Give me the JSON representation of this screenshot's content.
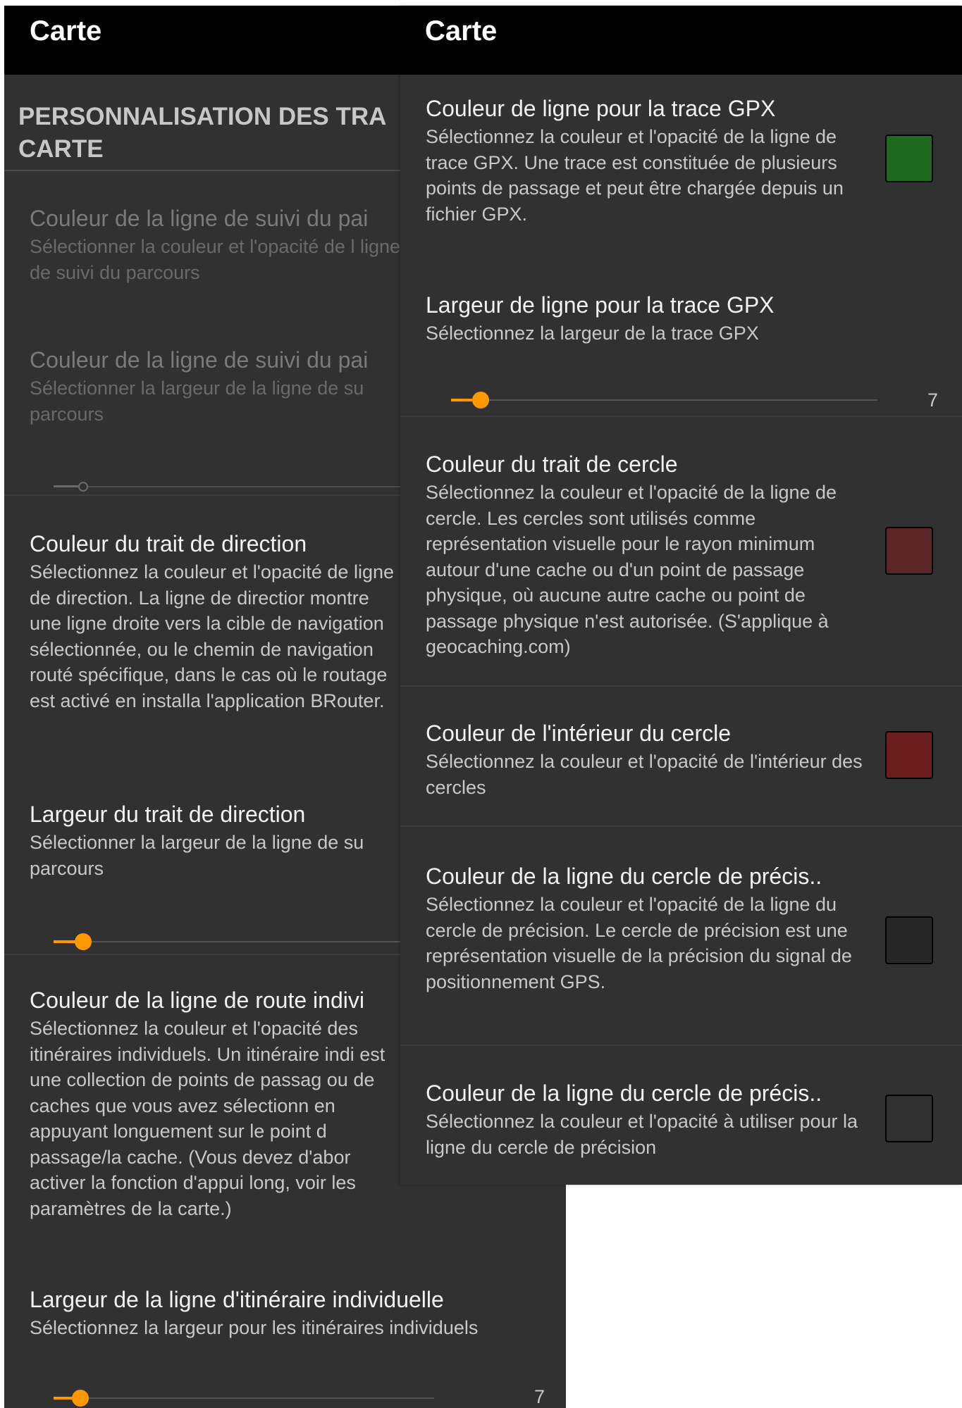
{
  "left": {
    "appbar_title": "Carte",
    "section_header": "PERSONNALISATION DES TRA CARTE",
    "items": [
      {
        "title": "Couleur de la ligne de suivi du pai",
        "summary": "Sélectionner la couleur et l'opacité de l ligne de suivi du parcours"
      },
      {
        "title": "Couleur de la ligne de suivi du pai",
        "summary": "Sélectionner la largeur de la ligne de su parcours"
      },
      {
        "title": "Couleur du trait de direction",
        "summary": "Sélectionnez la couleur et l'opacité de ligne de direction. La ligne de directior montre une ligne droite vers la cible de navigation sélectionnée, ou le chemin de navigation routé spécifique, dans le cas où le routage est activé en installa l'application BRouter."
      },
      {
        "title": "Largeur du trait de direction",
        "summary": "Sélectionner la largeur de la ligne de su parcours"
      },
      {
        "title": "Couleur de la ligne de route indivi",
        "summary": "Sélectionnez la couleur et l'opacité des itinéraires individuels. Un itinéraire indi est une collection de points de passag ou de caches que vous avez sélectionn en appuyant longuement sur le point d passage/la cache. (Vous devez d'abor activer la fonction d'appui long, voir les paramètres de la carte.)"
      },
      {
        "title": "Largeur de la ligne d'itinéraire individuelle",
        "summary": "Sélectionnez la largeur pour les itinéraires individuels"
      }
    ],
    "sliders": [
      {
        "name": "track-width",
        "fraction": 0.06
      },
      {
        "name": "direction-width",
        "fraction": 0.06
      },
      {
        "name": "route-width",
        "fraction": 0.07,
        "value": "7"
      }
    ]
  },
  "right": {
    "appbar_title": "Carte",
    "items": [
      {
        "title": "Couleur de ligne pour la trace GPX",
        "summary": "Sélectionnez la couleur et l'opacité de la ligne de trace GPX. Une trace est constituée de plusieurs points de passage et peut être chargée depuis un fichier GPX.",
        "swatch": "#1d6a1e"
      },
      {
        "title": "Largeur de ligne pour la trace GPX",
        "summary": "Sélectionnez la largeur de la trace GPX",
        "slider_fraction": 0.07,
        "slider_value": "7"
      },
      {
        "title": "Couleur du trait de cercle",
        "summary": "Sélectionnez la couleur et l'opacité de la ligne de cercle. Les cercles sont utilisés comme représentation visuelle pour le rayon minimum autour d'une cache ou d'un point de passage physique, où aucune autre cache ou point de passage physique n'est autorisée. (S'applique à geocaching.com)",
        "swatch": "#5c2626"
      },
      {
        "title": "Couleur de l'intérieur du cercle",
        "summary": "Sélectionnez la couleur et l'opacité de l'intérieur des cercles",
        "swatch": "#6c1d1d"
      },
      {
        "title": "Couleur de la ligne du cercle de précis..",
        "summary": "Sélectionnez la couleur et l'opacité de la ligne du cercle de précision. Le cercle de précision est une représentation visuelle de la précision du signal de positionnement GPS.",
        "swatch": "#262626"
      },
      {
        "title": "Couleur de la ligne du cercle de précis..",
        "summary": "Sélectionnez la couleur et l'opacité à utiliser pour la ligne du cercle de précision",
        "swatch": "#303030"
      }
    ]
  },
  "colors": {
    "accent": "#ff9800",
    "background": "#313131",
    "appbar": "#000000"
  }
}
